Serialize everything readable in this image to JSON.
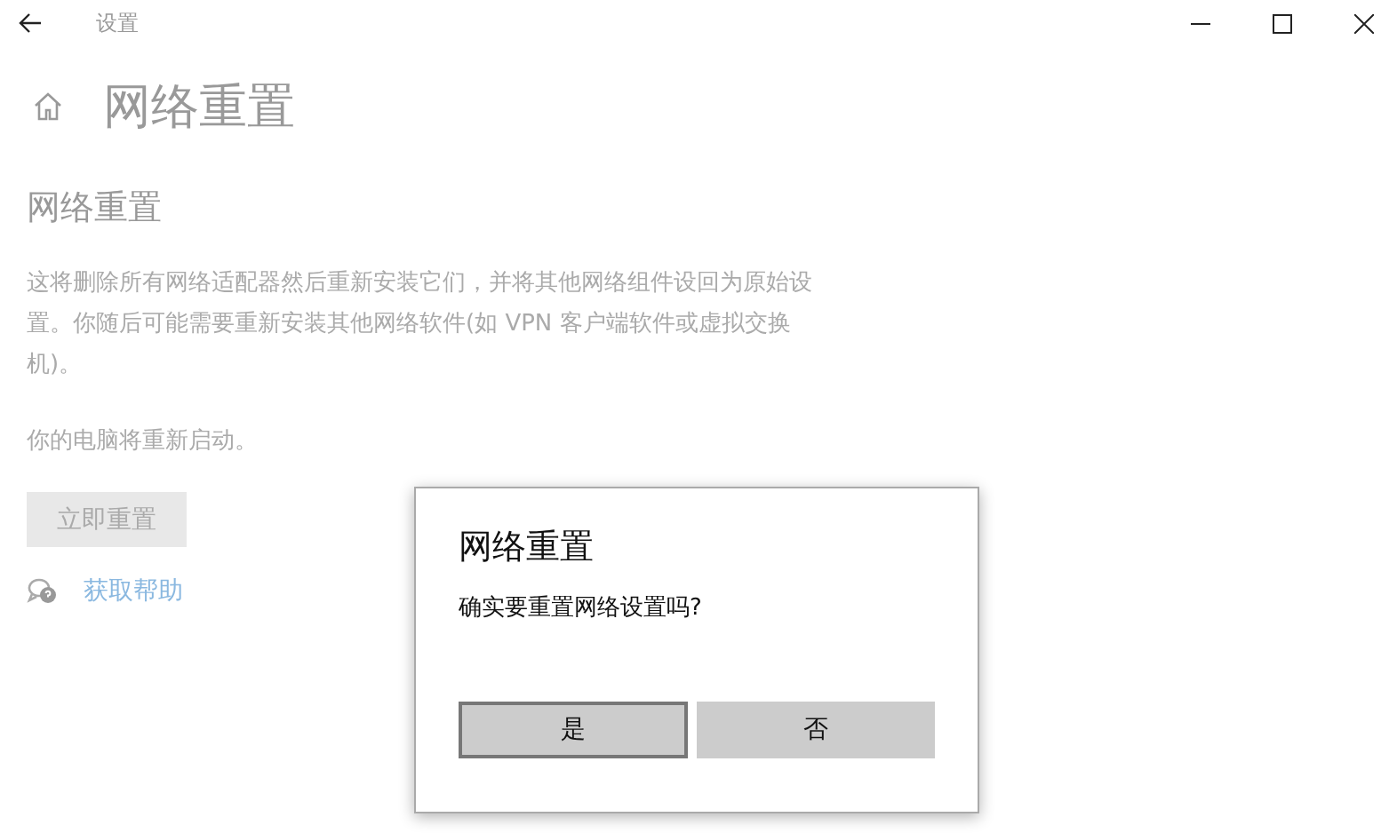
{
  "window": {
    "title": "设置",
    "controls": [
      {
        "kind": "minimize"
      },
      {
        "kind": "maximize"
      },
      {
        "kind": "close"
      }
    ]
  },
  "page": {
    "title": "网络重置",
    "section_title": "网络重置",
    "description": "这将删除所有网络适配器然后重新安装它们，并将其他网络组件设回为原始设置。你随后可能需要重新安装其他网络软件(如 VPN 客户端软件或虚拟交换机)。",
    "restart_note": "你的电脑将重新启动。",
    "reset_button": "立即重置",
    "help_link": "获取帮助"
  },
  "dialog": {
    "title": "网络重置",
    "message": "确实要重置网络设置吗?",
    "buttons": [
      {
        "label": "是",
        "focused": true
      },
      {
        "label": "否",
        "focused": false
      }
    ]
  }
}
